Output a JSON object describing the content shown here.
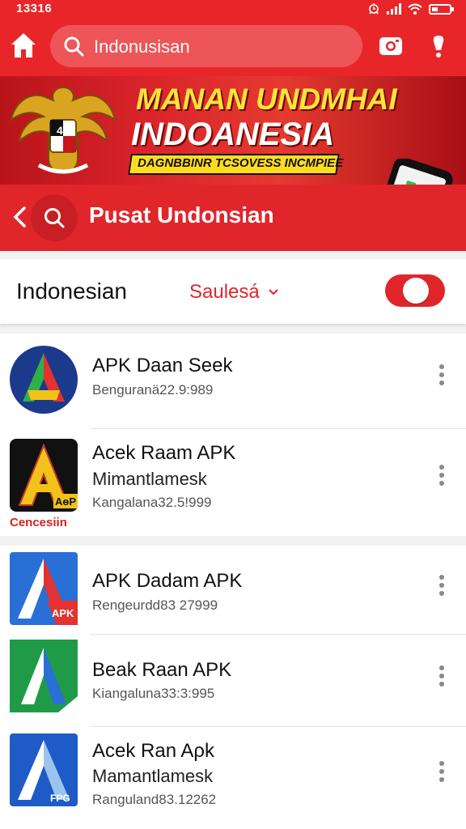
{
  "status_bar": {
    "time": "13316",
    "icons": [
      "alarm-icon",
      "signal-icon",
      "wifi-icon",
      "battery-icon"
    ]
  },
  "top_bar": {
    "search_text": "Indonusisan",
    "icons": [
      "home-icon",
      "search-icon",
      "camera-icon",
      "alert-icon"
    ]
  },
  "banner": {
    "line1": "MANAN UNDMHAI",
    "line2": "INDOANESIA",
    "tagline": "DAGNBBINR TCSOVESS INCMPIEE",
    "emblem_text": "45"
  },
  "sub_header": {
    "title": "Pusat Undonsian"
  },
  "filter": {
    "language": "Indonesian",
    "selection": "Saulesá",
    "toggle_on": true
  },
  "apps": [
    {
      "name": "APK Daan Seek",
      "developer": "",
      "meta": "Benguranä22.9:989",
      "icon": "blue-green-circle-a-icon",
      "caption": ""
    },
    {
      "name": "Acek Raam APK",
      "developer": "Mimantlamesk",
      "meta": "Kangalana32.5!999",
      "icon": "yellow-a-black-icon",
      "icon_badge": "AɵP",
      "caption": "Cencesiin"
    },
    {
      "name": "APK Dadam APK",
      "developer": "",
      "meta": "Rengeurdd83 27999",
      "icon": "red-blue-a-apk-icon",
      "icon_badge": "APK",
      "caption": ""
    },
    {
      "name": "Beak Raan APK",
      "developer": "",
      "meta": "Kiangaluna33:3:995",
      "icon": "green-blue-a-icon",
      "caption": ""
    },
    {
      "name": "Acek Ran Aρk",
      "developer": "Mamantlamesk",
      "meta": "Ranguland83.12262",
      "icon": "blue-a-fpg-icon",
      "icon_badge": "FPG",
      "caption": ""
    }
  ],
  "colors": {
    "primary_red": "#e8262a",
    "dark_red": "#c81f24",
    "banner_yellow": "#ffe43b"
  }
}
